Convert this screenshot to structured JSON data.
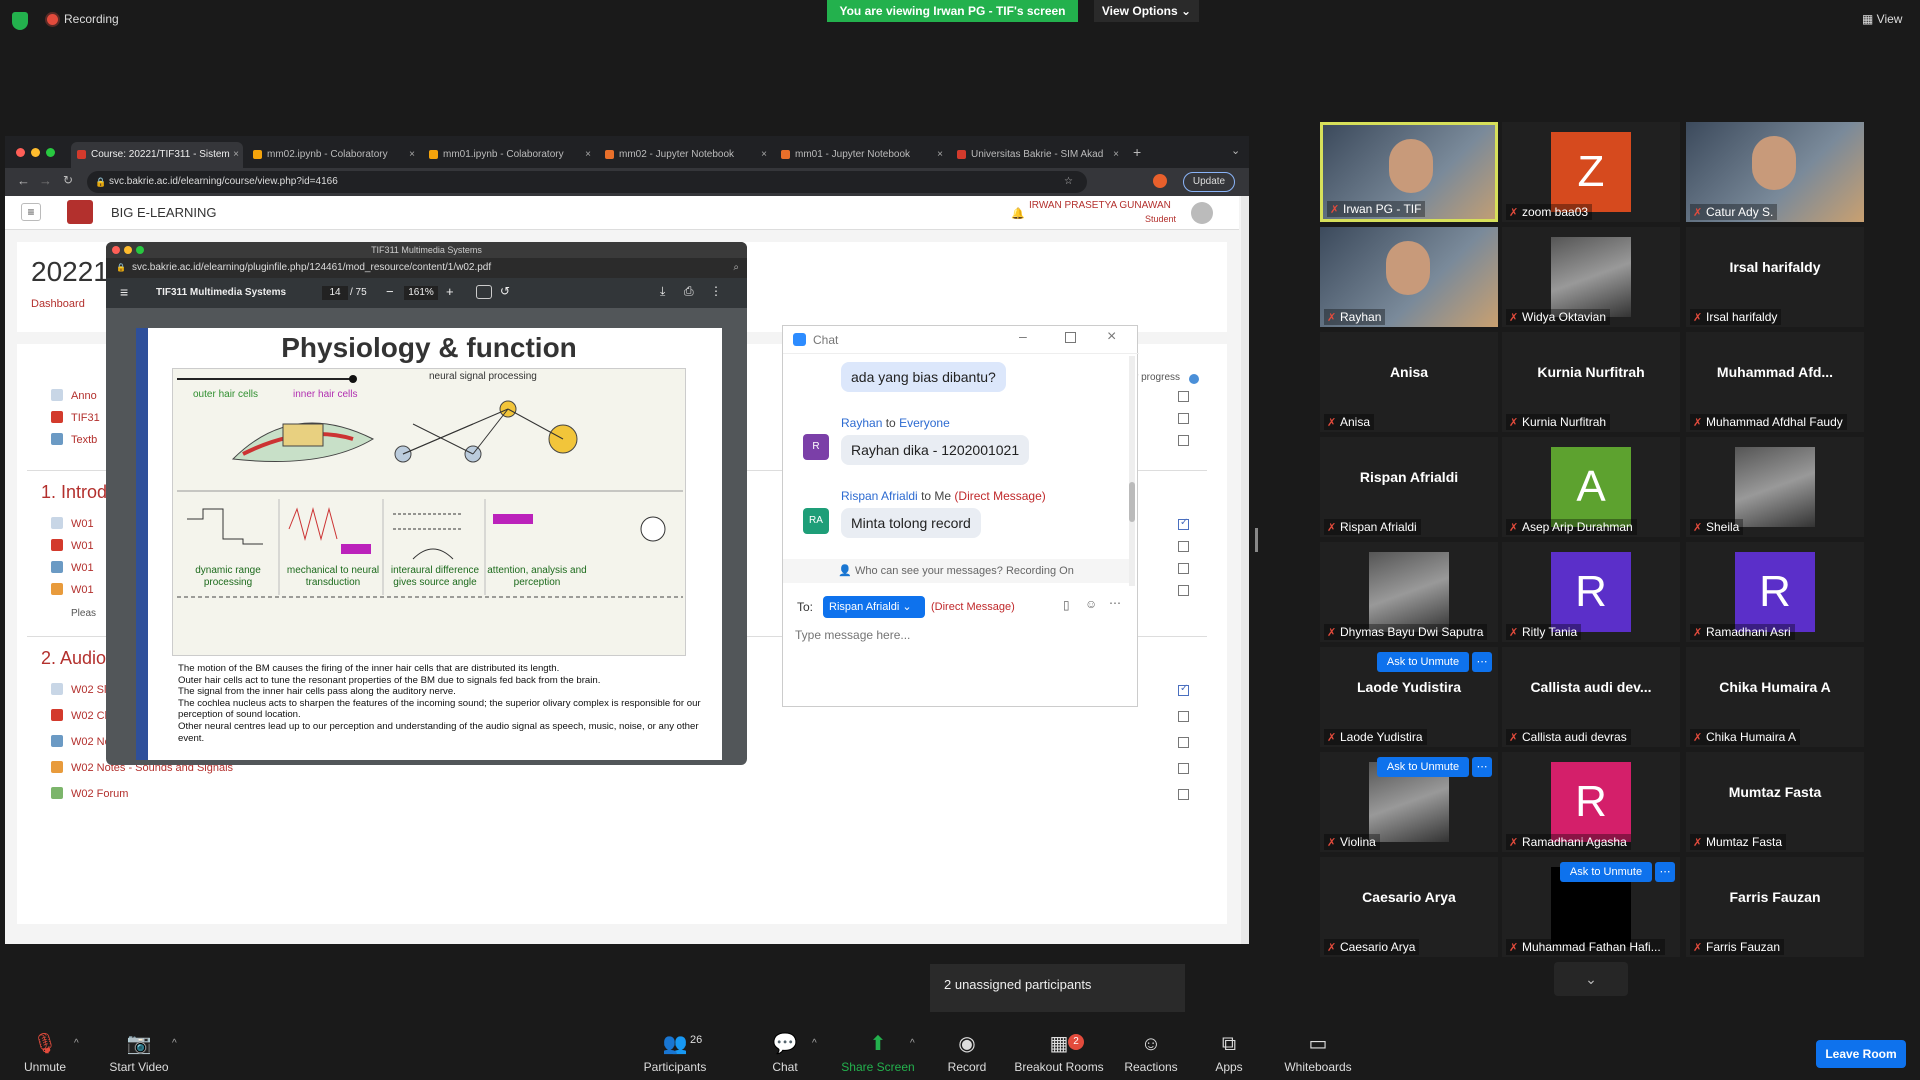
{
  "top": {
    "recording": "Recording",
    "viewing_banner": "You are viewing Irwan PG - TIF's screen",
    "view_options": "View Options",
    "view": "View"
  },
  "browser": {
    "tabs": [
      {
        "label": "Course: 20221/TIF311 - Sistem",
        "icon_color": "#d33a2c"
      },
      {
        "label": "mm02.ipynb - Colaboratory",
        "icon_color": "#f4a30b"
      },
      {
        "label": "mm01.ipynb - Colaboratory",
        "icon_color": "#f4a30b"
      },
      {
        "label": "mm02 - Jupyter Notebook",
        "icon_color": "#e86f2a"
      },
      {
        "label": "mm01 - Jupyter Notebook",
        "icon_color": "#e86f2a"
      },
      {
        "label": "Universitas Bakrie - SIM Akad",
        "icon_color": "#d33a2c"
      }
    ],
    "url": "svc.bakrie.ac.id/elearning/course/view.php?id=4166",
    "update": "Update"
  },
  "moodle": {
    "site_name": "BIG E-LEARNING",
    "user_name": "IRWAN PRASETYA GUNAWAN",
    "user_role": "Student",
    "course_title": "20221",
    "breadcrumb": "Dashboard",
    "progress": "r progress",
    "sections": [
      {
        "title": "1. Introd"
      },
      {
        "title": "2. Audio"
      }
    ],
    "top_items": [
      "Anno",
      "TIF31",
      "Textb"
    ],
    "sec1_items": [
      "W01",
      "W01",
      "W01",
      "W01"
    ],
    "please": "Pleas",
    "sec2_items": [
      "W02 Slide: Audio",
      "W02 Class Presence Documentation",
      "W02 Notes - Introduction to Notebook",
      "W02 Notes - Sounds and Signals",
      "W02 Forum"
    ]
  },
  "pdf": {
    "window_title": "TIF311 Multimedia Systems",
    "url": "svc.bakrie.ac.id/elearning/pluginfile.php/124461/mod_resource/content/1/w02.pdf",
    "doc_title": "TIF311 Multimedia Systems",
    "page": "14",
    "pages": "/ 75",
    "zoom": "161%",
    "slide_title": "Physiology & function",
    "diagram_labels": {
      "outer": "outer hair cells",
      "inner": "inner hair cells",
      "neural": "neural signal processing",
      "cap1": "dynamic range processing",
      "cap2": "mechanical to neural transduction",
      "cap3": "interaural difference gives source angle",
      "cap4": "attention, analysis and perception"
    },
    "bullets": [
      "The motion of the BM causes the firing of the inner hair cells that are distributed its length.",
      "Outer hair cells act to tune the resonant properties of the BM due to signals fed back from the brain.",
      "The signal from the inner hair cells pass along the auditory nerve.",
      "The cochlea nucleus acts to sharpen the features of the incoming sound; the superior olivary complex is responsible for our perception of sound location.",
      "Other neural centres lead up to our perception and understanding of the audio signal as speech, music, noise, or any other event."
    ]
  },
  "chat": {
    "title": "Chat",
    "msg1": "ada yang bias dibantu?",
    "sender2": "Rayhan",
    "to2": "to",
    "target2": "Everyone",
    "avatar2": "R",
    "msg2": "Rayhan dika - 1202001021",
    "sender3": "Rispan Afrialdi",
    "to3": "to Me",
    "dm3": "(Direct Message)",
    "avatar3": "RA",
    "msg3": "Minta tolong record",
    "notice": "Who can see your messages? Recording On",
    "to_label": "To:",
    "recipient": "Rispan Afrialdi",
    "dm_label": "(Direct Message)",
    "placeholder": "Type message here..."
  },
  "gallery": [
    {
      "label": "Irwan PG - TIF",
      "type": "video",
      "selected": true
    },
    {
      "label": "zoom baa03",
      "type": "letter",
      "letter": "Z",
      "color": "#d64a1e"
    },
    {
      "label": "Catur Ady S.",
      "type": "video"
    },
    {
      "label": "Rayhan",
      "type": "video"
    },
    {
      "label": "Widya Oktavian",
      "type": "photo"
    },
    {
      "label": "Irsal harifaldy",
      "type": "name",
      "name": "Irsal harifaldy"
    },
    {
      "label": "Anisa",
      "type": "name",
      "name": "Anisa"
    },
    {
      "label": "Kurnia Nurfitrah",
      "type": "name",
      "name": "Kurnia Nurfitrah"
    },
    {
      "label": "Muhammad Afdhal Faudy",
      "type": "name",
      "name": "Muhammad  Afd..."
    },
    {
      "label": "Rispan Afrialdi",
      "type": "name",
      "name": "Rispan Afrialdi"
    },
    {
      "label": "Asep Arip Durahman",
      "type": "letter",
      "letter": "A",
      "color": "#5da22f"
    },
    {
      "label": "Sheila",
      "type": "photo"
    },
    {
      "label": "Dhymas Bayu Dwi Saputra",
      "type": "photo"
    },
    {
      "label": "Ritly Tania",
      "type": "letter",
      "letter": "R",
      "color": "#5b2fc9"
    },
    {
      "label": "Ramadhani Asri",
      "type": "letter",
      "letter": "R",
      "color": "#5b2fc9"
    },
    {
      "label": "Laode Yudistira",
      "type": "name",
      "name": "Laode Yudistira"
    },
    {
      "label": "Callista audi devras",
      "type": "name",
      "name": "Callista  audi  dev..."
    },
    {
      "label": "Chika Humaira A",
      "type": "name",
      "name": "Chika Humaira A"
    },
    {
      "label": "Violina",
      "type": "photo"
    },
    {
      "label": "Ramadhani Agasha",
      "type": "letter",
      "letter": "R",
      "color": "#d41f6a"
    },
    {
      "label": "Mumtaz Fasta",
      "type": "name",
      "name": "Mumtaz Fasta"
    },
    {
      "label": "Caesario Arya",
      "type": "name",
      "name": "Caesario Arya"
    },
    {
      "label": "Muhammad Fathan Hafi...",
      "type": "black"
    },
    {
      "label": "Farris Fauzan",
      "type": "name",
      "name": "Farris Fauzan"
    }
  ],
  "ask_unmute": "Ask to Unmute",
  "unassigned": "2 unassigned participants",
  "toolbar": {
    "unmute": "Unmute",
    "start_video": "Start Video",
    "participants": "Participants",
    "participants_count": "26",
    "chat": "Chat",
    "share": "Share Screen",
    "record": "Record",
    "breakout": "Breakout Rooms",
    "breakout_badge": "2",
    "reactions": "Reactions",
    "apps": "Apps",
    "whiteboards": "Whiteboards",
    "leave": "Leave Room"
  },
  "colors": {
    "zoom_blue": "#0e72ed",
    "green": "#23b14d",
    "moodle_red": "#b3302d",
    "selected_tile": "#d7e05a"
  }
}
